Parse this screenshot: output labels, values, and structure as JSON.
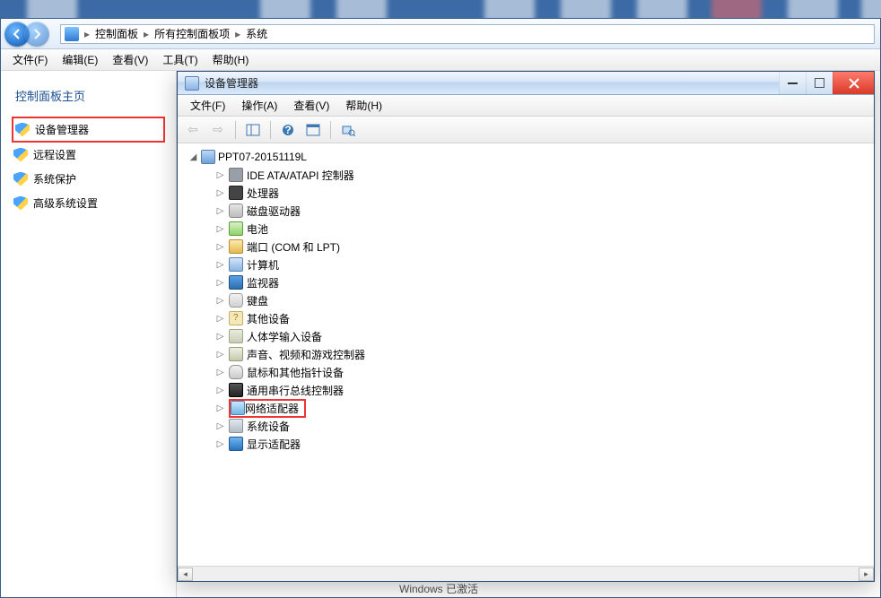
{
  "breadcrumb": {
    "root": "控制面板",
    "mid": "所有控制面板项",
    "leaf": "系统"
  },
  "cp_menu": [
    "文件(F)",
    "编辑(E)",
    "查看(V)",
    "工具(T)",
    "帮助(H)"
  ],
  "sidebar": {
    "title": "控制面板主页",
    "items": [
      "设备管理器",
      "远程设置",
      "系统保护",
      "高级系统设置"
    ]
  },
  "devmgr": {
    "title": "设备管理器",
    "menu": [
      "文件(F)",
      "操作(A)",
      "查看(V)",
      "帮助(H)"
    ],
    "root_label": "PPT07-20151119L",
    "categories": [
      {
        "label": "IDE ATA/ATAPI 控制器",
        "ico": "ico-ide"
      },
      {
        "label": "处理器",
        "ico": "ico-cpu"
      },
      {
        "label": "磁盘驱动器",
        "ico": "ico-disk"
      },
      {
        "label": "电池",
        "ico": "ico-batt"
      },
      {
        "label": "端口 (COM 和 LPT)",
        "ico": "ico-port"
      },
      {
        "label": "计算机",
        "ico": "ico-comp"
      },
      {
        "label": "监视器",
        "ico": "ico-mon"
      },
      {
        "label": "键盘",
        "ico": "ico-kbd"
      },
      {
        "label": "其他设备",
        "ico": "ico-other"
      },
      {
        "label": "人体学输入设备",
        "ico": "ico-hid"
      },
      {
        "label": "声音、视频和游戏控制器",
        "ico": "ico-snd"
      },
      {
        "label": "鼠标和其他指针设备",
        "ico": "ico-mouse"
      },
      {
        "label": "通用串行总线控制器",
        "ico": "ico-usb"
      },
      {
        "label": "网络适配器",
        "ico": "ico-net",
        "highlight": true
      },
      {
        "label": "系统设备",
        "ico": "ico-sys"
      },
      {
        "label": "显示适配器",
        "ico": "ico-disp"
      }
    ]
  },
  "footer_peek": "Windows 已激活"
}
